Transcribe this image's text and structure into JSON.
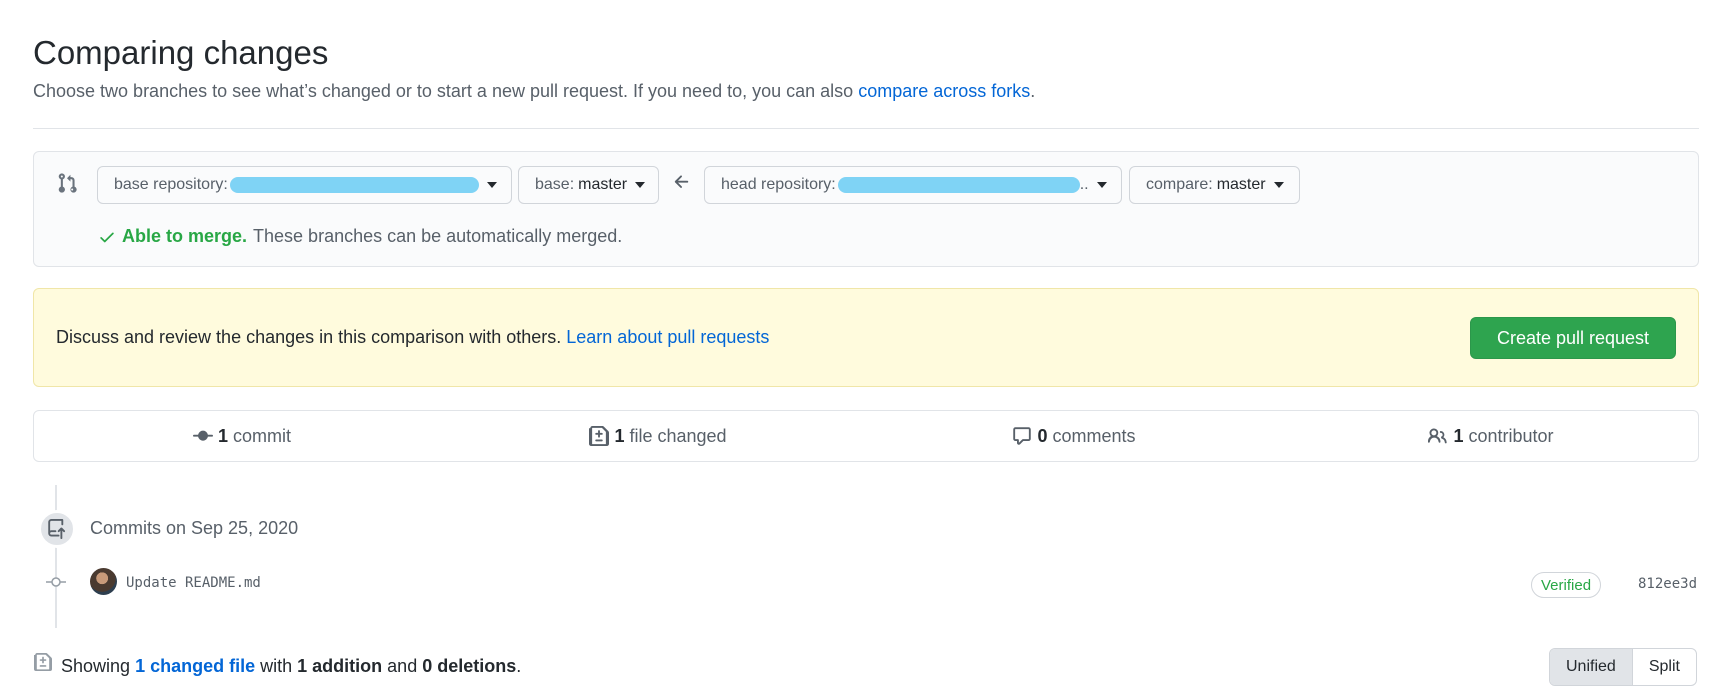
{
  "header": {
    "title": "Comparing changes",
    "subtitle": "Choose two branches to see what’s changed or to start a new pull request. If you need to, you can also",
    "subtitle_link": "compare across forks",
    "subtitle_end": "."
  },
  "range": {
    "base_repo_label": "base repository:",
    "base_label": "base:",
    "base_value": "master",
    "head_repo_label": "head repository:",
    "head_repo_suffix": "..",
    "compare_label": "compare:",
    "compare_value": "master",
    "merge_status": "Able to merge.",
    "merge_detail": "These branches can be automatically merged."
  },
  "flash": {
    "text": "Discuss and review the changes in this comparison with others.",
    "link": "Learn about pull requests",
    "button": "Create pull request"
  },
  "summary": {
    "commits_count": "1",
    "commits_label": "commit",
    "files_count": "1",
    "files_label": "file changed",
    "comments_count": "0",
    "comments_label": "comments",
    "contributors_count": "1",
    "contributors_label": "contributor"
  },
  "commits": {
    "date_header": "Commits on Sep 25, 2020",
    "items": [
      {
        "message": "Update README.md",
        "badge": "Verified",
        "sha": "812ee3d"
      }
    ]
  },
  "diffstat": {
    "prefix": "Showing",
    "files_link": "1 changed file",
    "with": "with",
    "additions": "1 addition",
    "and": "and",
    "deletions": "0 deletions",
    "end": "."
  },
  "view_toggle": {
    "unified": "Unified",
    "split": "Split"
  },
  "colors": {
    "accent": "#0366d6",
    "success": "#2ea44f",
    "flash_bg": "#fffbdd",
    "redaction": "#7fd3f5"
  }
}
